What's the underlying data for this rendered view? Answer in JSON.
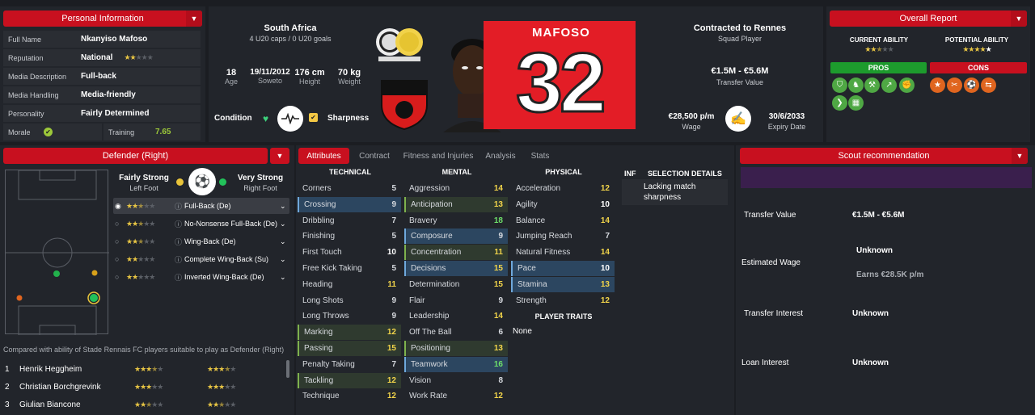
{
  "personal": {
    "title": "Personal Information",
    "rows": [
      {
        "k": "Full Name",
        "v": "Nkanyiso Mafoso"
      },
      {
        "k": "Reputation",
        "v": "National"
      },
      {
        "k": "Media Description",
        "v": "Full-back"
      },
      {
        "k": "Media Handling",
        "v": "Media-friendly"
      },
      {
        "k": "Personality",
        "v": "Fairly Determined"
      }
    ],
    "reputation_stars": 1.5,
    "morale_label": "Morale",
    "training_label": "Training",
    "training_value": "7.65"
  },
  "nation": {
    "name": "South Africa",
    "caps": "4 U20 caps / 0 U20 goals"
  },
  "bio": [
    {
      "v": "18",
      "l": "Age"
    },
    {
      "v": "19/11/2012",
      "l": "Soweto"
    },
    {
      "v": "176 cm",
      "l": "Height"
    },
    {
      "v": "70 kg",
      "l": "Weight"
    }
  ],
  "condition_label": "Condition",
  "sharpness_label": "Sharpness",
  "shirt": {
    "name": "MAFOSO",
    "number": "32"
  },
  "contract": {
    "title": "Contracted to Rennes",
    "role": "Squad Player",
    "value": "€1.5M - €5.6M",
    "value_label": "Transfer Value",
    "wage": "€28,500 p/m",
    "wage_label": "Wage",
    "expiry": "30/6/2033",
    "expiry_label": "Expiry Date"
  },
  "overall": {
    "title": "Overall Report",
    "current_label": "CURRENT ABILITY",
    "potential_label": "POTENTIAL ABILITY",
    "current_stars": 2.5,
    "potential_stars": 4.5,
    "pros": "PROS",
    "cons": "CONS"
  },
  "position": {
    "title": "Defender (Right)",
    "left_foot_rating": "Fairly Strong",
    "left_foot": "Left Foot",
    "right_foot_rating": "Very Strong",
    "right_foot": "Right Foot",
    "roles": [
      {
        "name": "Full-Back (De)",
        "stars": 2.5
      },
      {
        "name": "No-Nonsense Full-Back (De)",
        "stars": 2.5
      },
      {
        "name": "Wing-Back (De)",
        "stars": 2.5
      },
      {
        "name": "Complete Wing-Back (Su)",
        "stars": 2
      },
      {
        "name": "Inverted Wing-Back (De)",
        "stars": 2
      }
    ],
    "compare_text": "Compared with ability of Stade Rennais FC players suitable to play as Defender (Right)",
    "compare": [
      {
        "rank": "1",
        "name": "Henrik Heggheim",
        "a": 3.5,
        "p": 3.5
      },
      {
        "rank": "2",
        "name": "Christian Borchgrevink",
        "a": 3,
        "p": 3
      },
      {
        "rank": "3",
        "name": "Giulian Biancone",
        "a": 2.5,
        "p": 2.5
      }
    ]
  },
  "tabs": [
    "Attributes",
    "Contract",
    "Fitness and Injuries",
    "Analysis",
    "Stats"
  ],
  "attributes": {
    "technical_title": "TECHNICAL",
    "mental_title": "MENTAL",
    "physical_title": "PHYSICAL",
    "technical": [
      [
        "Corners",
        "5"
      ],
      [
        "Crossing",
        "9"
      ],
      [
        "Dribbling",
        "7"
      ],
      [
        "Finishing",
        "5"
      ],
      [
        "First Touch",
        "10"
      ],
      [
        "Free Kick Taking",
        "5"
      ],
      [
        "Heading",
        "11"
      ],
      [
        "Long Shots",
        "9"
      ],
      [
        "Long Throws",
        "9"
      ],
      [
        "Marking",
        "12"
      ],
      [
        "Passing",
        "15"
      ],
      [
        "Penalty Taking",
        "7"
      ],
      [
        "Tackling",
        "12"
      ],
      [
        "Technique",
        "12"
      ]
    ],
    "mental": [
      [
        "Aggression",
        "14"
      ],
      [
        "Anticipation",
        "13"
      ],
      [
        "Bravery",
        "18"
      ],
      [
        "Composure",
        "9"
      ],
      [
        "Concentration",
        "11"
      ],
      [
        "Decisions",
        "15"
      ],
      [
        "Determination",
        "15"
      ],
      [
        "Flair",
        "9"
      ],
      [
        "Leadership",
        "14"
      ],
      [
        "Off The Ball",
        "6"
      ],
      [
        "Positioning",
        "13"
      ],
      [
        "Teamwork",
        "16"
      ],
      [
        "Vision",
        "8"
      ],
      [
        "Work Rate",
        "12"
      ]
    ],
    "physical": [
      [
        "Acceleration",
        "12"
      ],
      [
        "Agility",
        "10"
      ],
      [
        "Balance",
        "14"
      ],
      [
        "Jumping Reach",
        "7"
      ],
      [
        "Natural Fitness",
        "14"
      ],
      [
        "Pace",
        "10"
      ],
      [
        "Stamina",
        "13"
      ],
      [
        "Strength",
        "12"
      ]
    ],
    "traits_title": "PLAYER TRAITS",
    "traits": "None"
  },
  "inf": {
    "title": "INF",
    "sel_title": "SELECTION DETAILS",
    "sel_text": "Lacking match sharpness"
  },
  "scout": {
    "title": "Scout recommendation",
    "rows": [
      {
        "k": "Transfer Value",
        "v": "€1.5M - €5.6M"
      },
      {
        "k": "Estimated Wage",
        "v": "Unknown",
        "sub": "Earns €28.5K p/m"
      },
      {
        "k": "Transfer Interest",
        "v": "Unknown"
      },
      {
        "k": "Loan Interest",
        "v": "Unknown"
      }
    ]
  },
  "colors": {
    "accent": "#c8101f",
    "pros": "#1d9b2d",
    "cons": "#c8101f"
  }
}
